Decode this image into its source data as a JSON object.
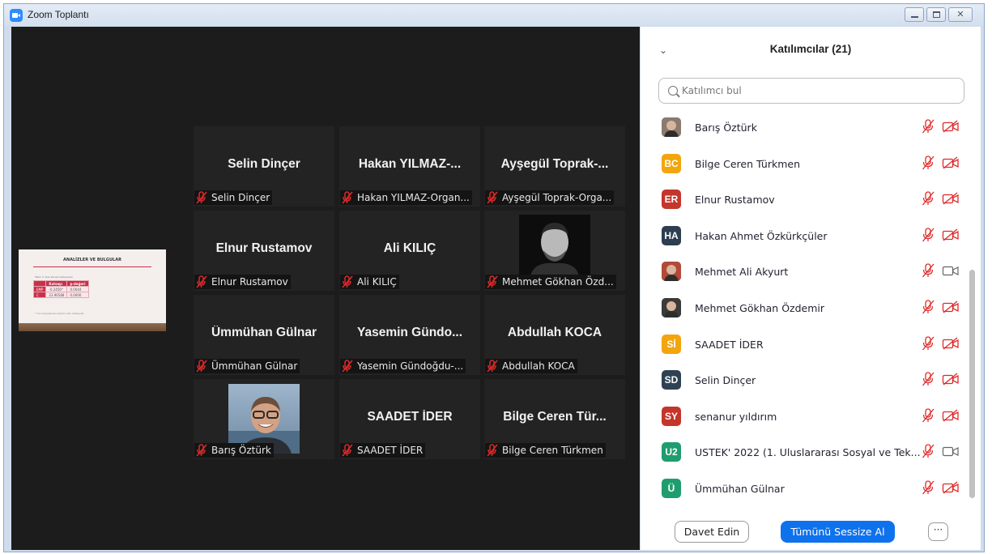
{
  "window": {
    "title": "Zoom Toplantı",
    "close_glyph": "✕"
  },
  "video_grid": {
    "tiles": [
      {
        "name": "Selin Dinçer",
        "label": "Selin Dinçer"
      },
      {
        "name": "Hakan YILMAZ-...",
        "label": "Hakan YILMAZ-Organ..."
      },
      {
        "name": "Ayşegül Toprak-...",
        "label": "Ayşegül Toprak-Orga..."
      },
      {
        "name": "Elnur Rustamov",
        "label": "Elnur Rustamov"
      },
      {
        "name": "Ali KILIÇ",
        "label": "Ali KILIÇ"
      },
      {
        "name": "",
        "label": "Mehmet Gökhan Özd..."
      },
      {
        "name": "Ümmühan Gülnar",
        "label": "Ümmühan Gülnar"
      },
      {
        "name": "Yasemin Gündo...",
        "label": "Yasemin Gündoğdu-..."
      },
      {
        "name": "Abdullah KOCA",
        "label": "Abdullah KOCA"
      },
      {
        "name": "",
        "label": "Barış Öztürk"
      },
      {
        "name": "SAADET İDER",
        "label": "SAADET İDER"
      },
      {
        "name": "Bilge Ceren Tür...",
        "label": "Bilge Ceren Türkmen"
      }
    ]
  },
  "shared_slide": {
    "title": "ANALİZLER VE BULGULAR",
    "note": "Tablo 3: Kısa Dönem Katsayıları",
    "table": [
      [
        "",
        "Katsayı",
        "p-değeri"
      ],
      [
        "EMP",
        "-0.2456*",
        "0.0044"
      ],
      [
        "C",
        "23.96588",
        "0.0000"
      ]
    ],
    "footnote": "* %1 seviyesinde anlamlı olan katsayılar"
  },
  "participants_panel": {
    "collapse_glyph": "⌄",
    "title": "Katılımcılar (21)",
    "search_placeholder": "Katılımcı bul",
    "participants": [
      {
        "name": "Barış Öztürk",
        "initials": "",
        "color": "#8a7a70",
        "avatar_type": "photo",
        "camera": "off"
      },
      {
        "name": "Bilge Ceren Türkmen",
        "initials": "BC",
        "color": "#f2a50c",
        "avatar_type": "initials",
        "camera": "off"
      },
      {
        "name": "Elnur Rustamov",
        "initials": "ER",
        "color": "#c4352b",
        "avatar_type": "initials",
        "camera": "off"
      },
      {
        "name": "Hakan Ahmet Özkürkçüler",
        "initials": "HA",
        "color": "#2c3e50",
        "avatar_type": "initials",
        "camera": "off"
      },
      {
        "name": "Mehmet Ali Akyurt",
        "initials": "",
        "color": "#b24a3a",
        "avatar_type": "photo",
        "camera": "on"
      },
      {
        "name": "Mehmet Gökhan Özdemir",
        "initials": "",
        "color": "#3a3a3a",
        "avatar_type": "photo",
        "camera": "off"
      },
      {
        "name": "SAADET İDER",
        "initials": "Sİ",
        "color": "#f2a50c",
        "avatar_type": "initials",
        "camera": "off"
      },
      {
        "name": "Selin Dinçer",
        "initials": "SD",
        "color": "#2f4254",
        "avatar_type": "initials",
        "camera": "off"
      },
      {
        "name": "senanur yıldırım",
        "initials": "SY",
        "color": "#c4352b",
        "avatar_type": "initials",
        "camera": "off"
      },
      {
        "name": "USTEK' 2022 (1. Uluslararası Sosyal ve Tek...",
        "initials": "U2",
        "color": "#1f9d6f",
        "avatar_type": "initials",
        "camera": "on"
      },
      {
        "name": "Ümmühan Gülnar",
        "initials": "Ü",
        "color": "#1f9d6f",
        "avatar_type": "initials",
        "camera": "off"
      }
    ],
    "invite_label": "Davet Edin",
    "mute_all_label": "Tümünü Sessize Al",
    "more_label": "···"
  },
  "colors": {
    "video_bg": "#1c1c1c",
    "tile_bg": "#232323",
    "mute_red": "#e02828",
    "primary_blue": "#0e72ed"
  },
  "icons": {
    "muted_mic": "mic-off-icon",
    "camera_off": "video-off-icon",
    "camera_on": "video-icon",
    "search": "search-icon"
  }
}
